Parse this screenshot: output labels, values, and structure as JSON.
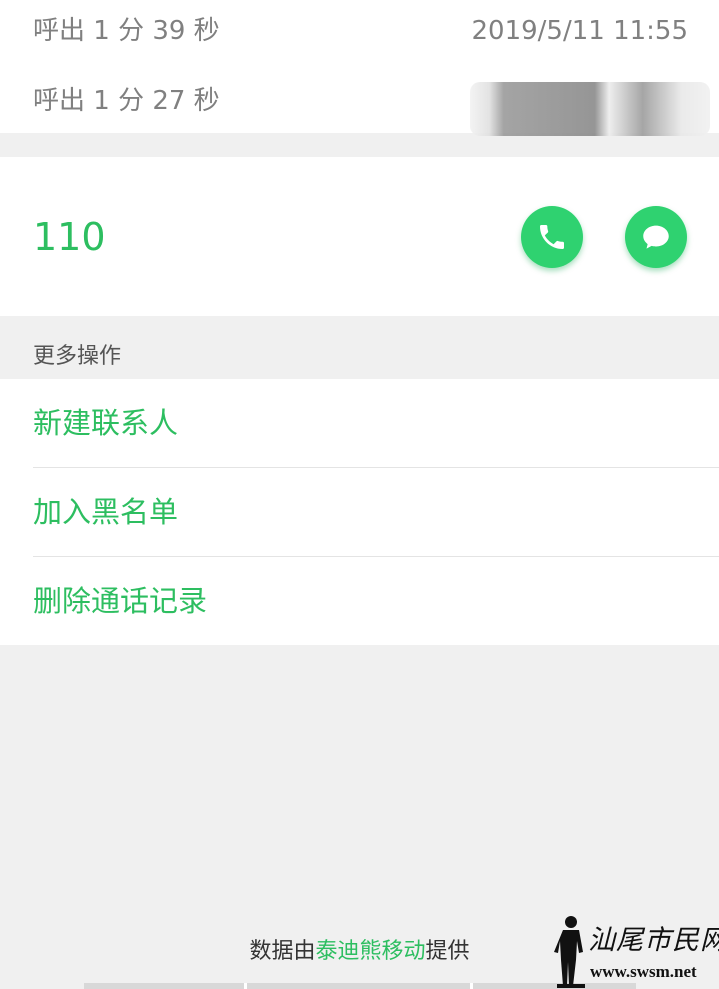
{
  "call_log": [
    {
      "description": "呼出 1 分 39 秒",
      "time": "2019/5/11 11:55"
    },
    {
      "description": "呼出 1 分 27 秒",
      "time": ""
    }
  ],
  "contact": {
    "number": "110",
    "call_icon": "phone-icon",
    "message_icon": "chat-bubble-icon"
  },
  "more_actions": {
    "title": "更多操作",
    "items": [
      {
        "label": "新建联系人"
      },
      {
        "label": "加入黑名单"
      },
      {
        "label": "删除通话记录"
      }
    ]
  },
  "footer": {
    "prefix": "数据由",
    "brand": "泰迪熊移动",
    "suffix": "提供"
  },
  "watermark": {
    "text": "汕尾市民网",
    "url": "www.swsm.net"
  },
  "colors": {
    "accent": "#2dbe60",
    "button": "#2fd270",
    "background": "#f0f0f0",
    "secondary_text": "#808080"
  }
}
